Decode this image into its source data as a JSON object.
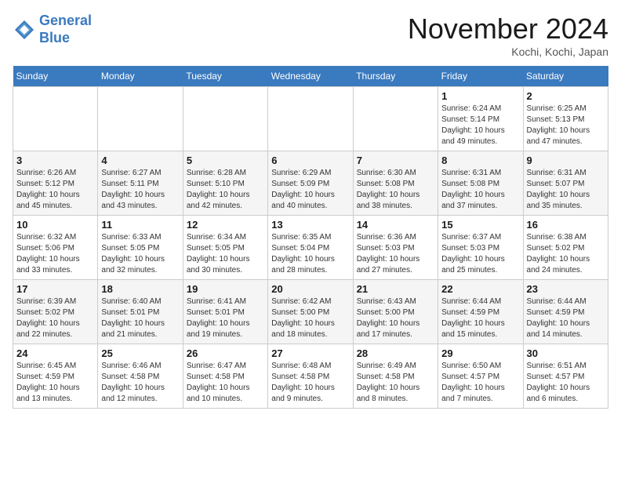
{
  "logo": {
    "line1": "General",
    "line2": "Blue"
  },
  "title": "November 2024",
  "location": "Kochi, Kochi, Japan",
  "weekdays": [
    "Sunday",
    "Monday",
    "Tuesday",
    "Wednesday",
    "Thursday",
    "Friday",
    "Saturday"
  ],
  "weeks": [
    [
      {
        "day": "",
        "info": ""
      },
      {
        "day": "",
        "info": ""
      },
      {
        "day": "",
        "info": ""
      },
      {
        "day": "",
        "info": ""
      },
      {
        "day": "",
        "info": ""
      },
      {
        "day": "1",
        "info": "Sunrise: 6:24 AM\nSunset: 5:14 PM\nDaylight: 10 hours and 49 minutes."
      },
      {
        "day": "2",
        "info": "Sunrise: 6:25 AM\nSunset: 5:13 PM\nDaylight: 10 hours and 47 minutes."
      }
    ],
    [
      {
        "day": "3",
        "info": "Sunrise: 6:26 AM\nSunset: 5:12 PM\nDaylight: 10 hours and 45 minutes."
      },
      {
        "day": "4",
        "info": "Sunrise: 6:27 AM\nSunset: 5:11 PM\nDaylight: 10 hours and 43 minutes."
      },
      {
        "day": "5",
        "info": "Sunrise: 6:28 AM\nSunset: 5:10 PM\nDaylight: 10 hours and 42 minutes."
      },
      {
        "day": "6",
        "info": "Sunrise: 6:29 AM\nSunset: 5:09 PM\nDaylight: 10 hours and 40 minutes."
      },
      {
        "day": "7",
        "info": "Sunrise: 6:30 AM\nSunset: 5:08 PM\nDaylight: 10 hours and 38 minutes."
      },
      {
        "day": "8",
        "info": "Sunrise: 6:31 AM\nSunset: 5:08 PM\nDaylight: 10 hours and 37 minutes."
      },
      {
        "day": "9",
        "info": "Sunrise: 6:31 AM\nSunset: 5:07 PM\nDaylight: 10 hours and 35 minutes."
      }
    ],
    [
      {
        "day": "10",
        "info": "Sunrise: 6:32 AM\nSunset: 5:06 PM\nDaylight: 10 hours and 33 minutes."
      },
      {
        "day": "11",
        "info": "Sunrise: 6:33 AM\nSunset: 5:05 PM\nDaylight: 10 hours and 32 minutes."
      },
      {
        "day": "12",
        "info": "Sunrise: 6:34 AM\nSunset: 5:05 PM\nDaylight: 10 hours and 30 minutes."
      },
      {
        "day": "13",
        "info": "Sunrise: 6:35 AM\nSunset: 5:04 PM\nDaylight: 10 hours and 28 minutes."
      },
      {
        "day": "14",
        "info": "Sunrise: 6:36 AM\nSunset: 5:03 PM\nDaylight: 10 hours and 27 minutes."
      },
      {
        "day": "15",
        "info": "Sunrise: 6:37 AM\nSunset: 5:03 PM\nDaylight: 10 hours and 25 minutes."
      },
      {
        "day": "16",
        "info": "Sunrise: 6:38 AM\nSunset: 5:02 PM\nDaylight: 10 hours and 24 minutes."
      }
    ],
    [
      {
        "day": "17",
        "info": "Sunrise: 6:39 AM\nSunset: 5:02 PM\nDaylight: 10 hours and 22 minutes."
      },
      {
        "day": "18",
        "info": "Sunrise: 6:40 AM\nSunset: 5:01 PM\nDaylight: 10 hours and 21 minutes."
      },
      {
        "day": "19",
        "info": "Sunrise: 6:41 AM\nSunset: 5:01 PM\nDaylight: 10 hours and 19 minutes."
      },
      {
        "day": "20",
        "info": "Sunrise: 6:42 AM\nSunset: 5:00 PM\nDaylight: 10 hours and 18 minutes."
      },
      {
        "day": "21",
        "info": "Sunrise: 6:43 AM\nSunset: 5:00 PM\nDaylight: 10 hours and 17 minutes."
      },
      {
        "day": "22",
        "info": "Sunrise: 6:44 AM\nSunset: 4:59 PM\nDaylight: 10 hours and 15 minutes."
      },
      {
        "day": "23",
        "info": "Sunrise: 6:44 AM\nSunset: 4:59 PM\nDaylight: 10 hours and 14 minutes."
      }
    ],
    [
      {
        "day": "24",
        "info": "Sunrise: 6:45 AM\nSunset: 4:59 PM\nDaylight: 10 hours and 13 minutes."
      },
      {
        "day": "25",
        "info": "Sunrise: 6:46 AM\nSunset: 4:58 PM\nDaylight: 10 hours and 12 minutes."
      },
      {
        "day": "26",
        "info": "Sunrise: 6:47 AM\nSunset: 4:58 PM\nDaylight: 10 hours and 10 minutes."
      },
      {
        "day": "27",
        "info": "Sunrise: 6:48 AM\nSunset: 4:58 PM\nDaylight: 10 hours and 9 minutes."
      },
      {
        "day": "28",
        "info": "Sunrise: 6:49 AM\nSunset: 4:58 PM\nDaylight: 10 hours and 8 minutes."
      },
      {
        "day": "29",
        "info": "Sunrise: 6:50 AM\nSunset: 4:57 PM\nDaylight: 10 hours and 7 minutes."
      },
      {
        "day": "30",
        "info": "Sunrise: 6:51 AM\nSunset: 4:57 PM\nDaylight: 10 hours and 6 minutes."
      }
    ]
  ]
}
